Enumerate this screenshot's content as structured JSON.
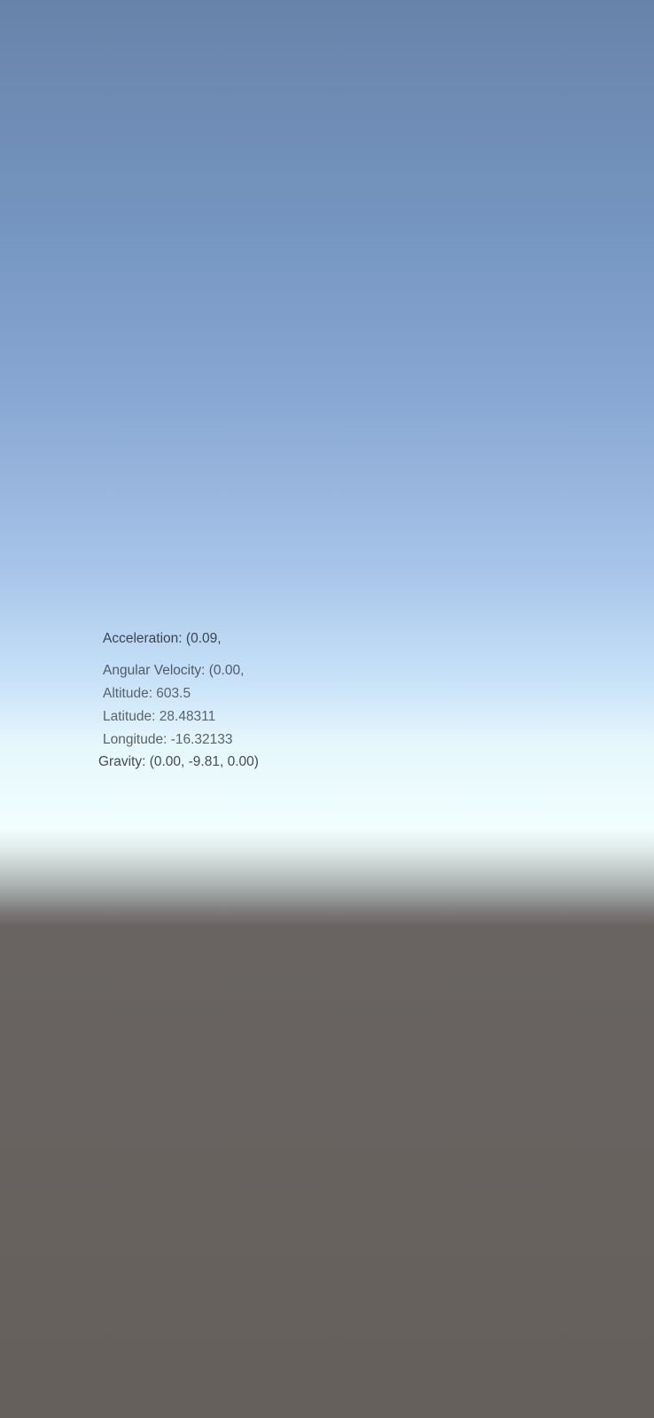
{
  "sensors": {
    "acceleration": "Acceleration: (0.09,",
    "angular_velocity": "Angular Velocity: (0.00,",
    "altitude": "Altitude: 603.5",
    "latitude": "Latitude: 28.48311",
    "longitude": "Longitude: -16.32133",
    "gravity": "Gravity: (0.00, -9.81, 0.00)"
  },
  "colors": {
    "sky_top": "#6883a9",
    "horizon": "#f1fefd",
    "ground": "#66605c",
    "text": "#3b4450"
  }
}
